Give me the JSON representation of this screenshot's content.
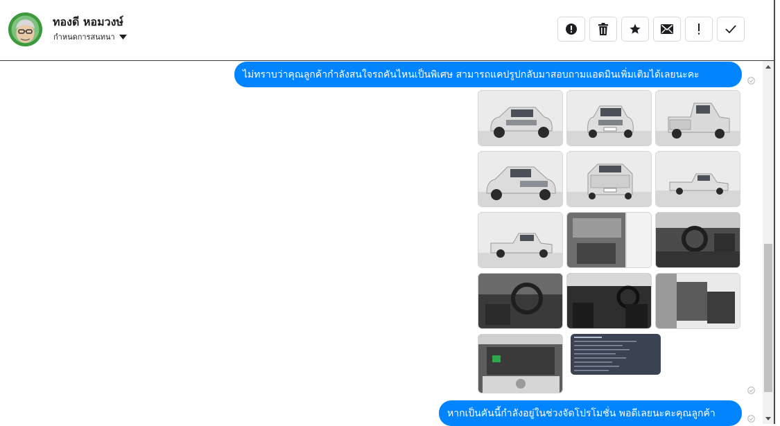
{
  "contact": {
    "name": "ทองดี หอมวงษ์",
    "label_action": "กำหนดการสนทนา"
  },
  "toolbar": [
    {
      "name": "report-button",
      "icon": "alert-circle-icon"
    },
    {
      "name": "delete-button",
      "icon": "trash-icon"
    },
    {
      "name": "star-button",
      "icon": "star-icon"
    },
    {
      "name": "mark-unread-button",
      "icon": "envelope-icon"
    },
    {
      "name": "mark-important-button",
      "icon": "exclamation-icon"
    },
    {
      "name": "mark-done-button",
      "icon": "checkmark-icon"
    }
  ],
  "messages": [
    {
      "text": "ไม่ทราบว่าคุณลูกค้ากำลังสนใจรถคันไหนเป็นพิเศษ สามารถแคปรูปกลับมาสอบถามแอดมินเพิ่มเติมได้เลยนะคะ",
      "status": "sent"
    },
    {
      "type": "photos",
      "count": 14,
      "status": "sent"
    },
    {
      "text": "หากเป็นคันนี้กำลังอยู่ในช่วงจัดโปรโมชั่น พอดีเลยนะคะคุณลูกค้า",
      "status": "sent"
    }
  ],
  "colors": {
    "bubble": "#0084ff",
    "avatar_bg": "#3c9a3c"
  }
}
